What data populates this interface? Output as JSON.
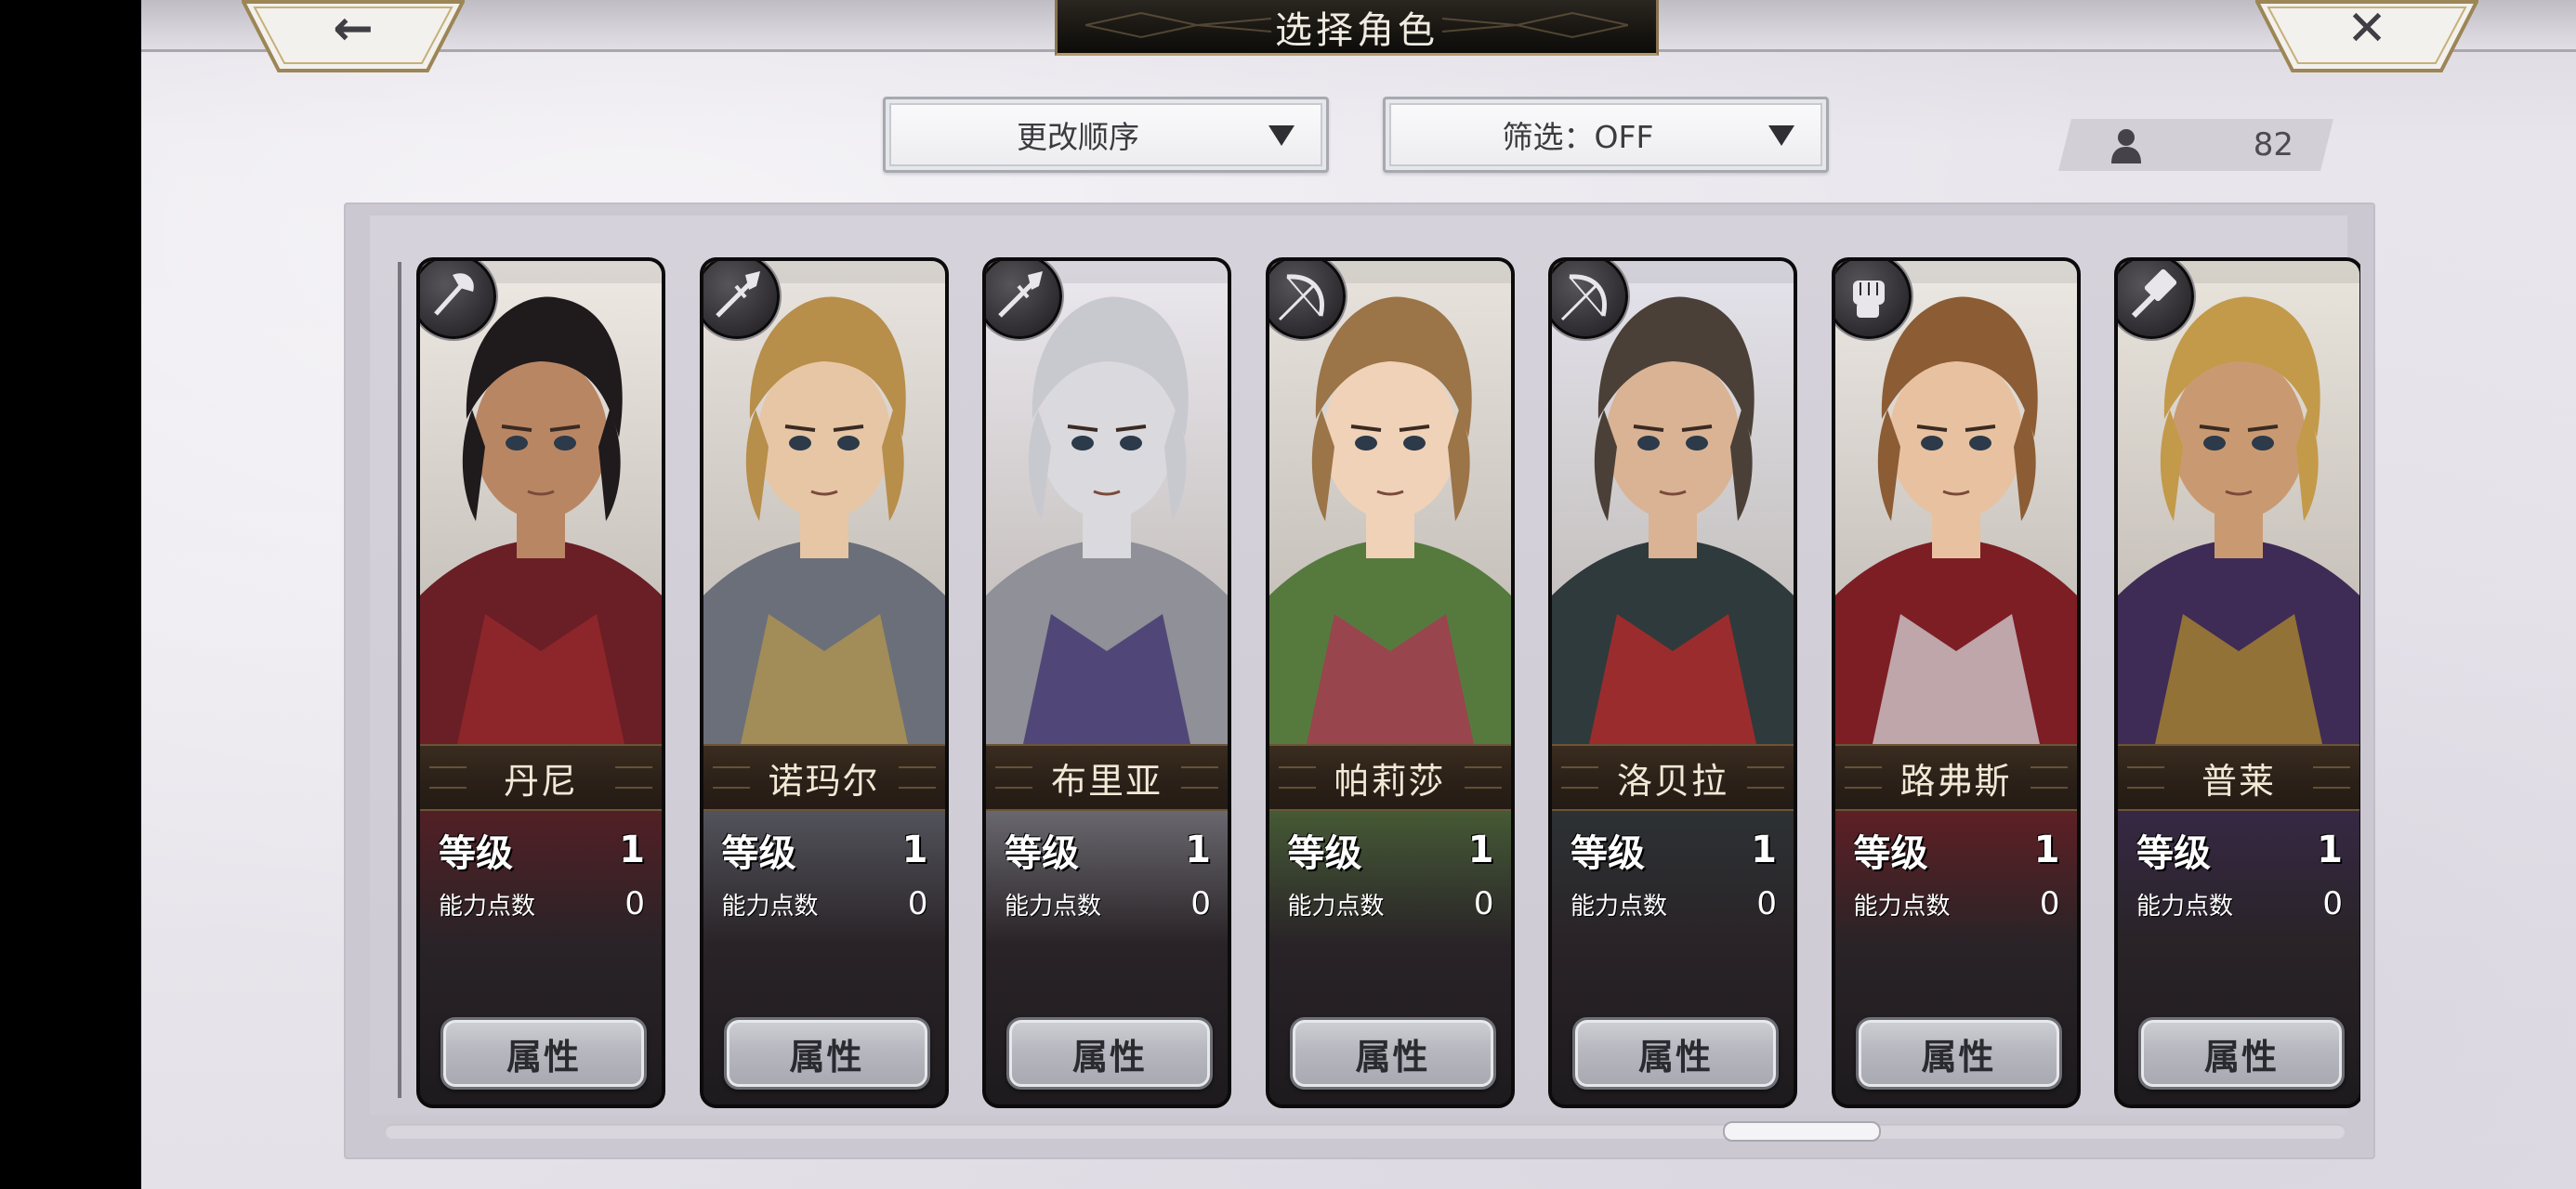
{
  "header": {
    "title": "选择角色",
    "back_icon": "←",
    "close_icon": "✕"
  },
  "controls": {
    "sort_label": "更改顺序",
    "filter_label": "筛选：OFF",
    "character_count": "82"
  },
  "cards": [
    {
      "name": "丹尼",
      "level_label": "等级",
      "level": "1",
      "ap_label": "能力点数",
      "ap": "0",
      "attr_label": "属性",
      "weapon": "axe-icon",
      "palette": {
        "bg": "#efe9e4",
        "hair": "#1f1a1c",
        "skin": "#b98664",
        "outfit": "#6a1e25",
        "accent": "#9a2a2c"
      }
    },
    {
      "name": "诺玛尔",
      "level_label": "等级",
      "level": "1",
      "ap_label": "能力点数",
      "ap": "0",
      "attr_label": "属性",
      "weapon": "spear-icon",
      "palette": {
        "bg": "#e9e4df",
        "hair": "#b78e4a",
        "skin": "#e6c6a5",
        "outfit": "#6b6f7a",
        "accent": "#b4964e"
      }
    },
    {
      "name": "布里亚",
      "level_label": "等级",
      "level": "1",
      "ap_label": "能力点数",
      "ap": "0",
      "attr_label": "属性",
      "weapon": "spear-icon",
      "palette": {
        "bg": "#ebe8ef",
        "hair": "#c8c9cf",
        "skin": "#d9d9de",
        "outfit": "#8f9098",
        "accent": "#3b2f6d"
      }
    },
    {
      "name": "帕莉莎",
      "level_label": "等级",
      "level": "1",
      "ap_label": "能力点数",
      "ap": "0",
      "attr_label": "属性",
      "weapon": "bow-icon",
      "palette": {
        "bg": "#e8e3dd",
        "hair": "#9b7447",
        "skin": "#efd2b8",
        "outfit": "#567a3e",
        "accent": "#b03453"
      }
    },
    {
      "name": "洛贝拉",
      "level_label": "等级",
      "level": "1",
      "ap_label": "能力点数",
      "ap": "0",
      "attr_label": "属性",
      "weapon": "bow-icon",
      "palette": {
        "bg": "#e4e3ec",
        "hair": "#4a4038",
        "skin": "#d9b394",
        "outfit": "#2f3a3c",
        "accent": "#c02828"
      }
    },
    {
      "name": "路弗斯",
      "level_label": "等级",
      "level": "1",
      "ap_label": "能力点数",
      "ap": "0",
      "attr_label": "属性",
      "weapon": "fist-icon",
      "palette": {
        "bg": "#ece8e3",
        "hair": "#8c5c34",
        "skin": "#e8c2a0",
        "outfit": "#7d1e24",
        "accent": "#d4d4d8"
      }
    },
    {
      "name": "普莱",
      "level_label": "等级",
      "level": "1",
      "ap_label": "能力点数",
      "ap": "0",
      "attr_label": "属性",
      "weapon": "hammer-icon",
      "palette": {
        "bg": "#e9e4dc",
        "hair": "#c39a4a",
        "skin": "#c99a72",
        "outfit": "#3e2c56",
        "accent": "#b08a2e"
      }
    }
  ]
}
